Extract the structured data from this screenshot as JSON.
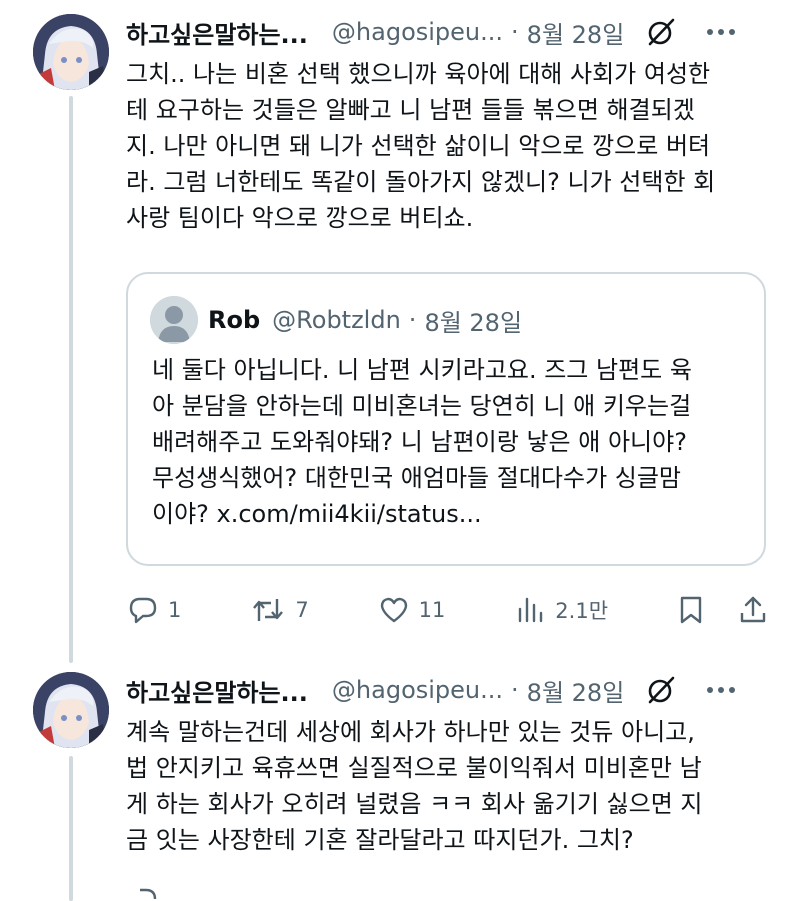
{
  "tweets": [
    {
      "author_name": "하고싶은말하는...",
      "handle": "@hagosipeu...",
      "separator": "·",
      "date": "8월 28일",
      "text": "그치.. 나는 비혼 선택 했으니까 육아에 대해 사회가 여성한\n테 요구하는 것들은 알빠고 니 남편 들들 볶으면 해결되겠\n지. 나만 아니면 돼 니가 선택한 삶이니 악으로 깡으로 버텨\n라. 그럼 너한테도 똑같이 돌아가지 않겠니? 니가 선택한 회\n사랑 팀이다 악으로 깡으로 버티쇼.",
      "quote": {
        "author_name": "Rob",
        "handle": "@Robtzldn",
        "separator": "·",
        "date": "8월 28일",
        "text": "네 둘다 아닙니다. 니 남편 시키라고요. 즈그 남편도 육\n아 분담을 안하는데 미비혼녀는 당연히 니 애 키우는걸\n배려해주고 도와줘야돼? 니 남편이랑 낳은 애 아니야?\n무성생식했어? 대한민국 애엄마들 절대다수가 싱글맘\n이야? x.com/mii4kii/status..."
      },
      "stats": {
        "replies": "1",
        "reposts": "7",
        "likes": "11",
        "views": "2.1만"
      }
    },
    {
      "author_name": "하고싶은말하는...",
      "handle": "@hagosipeu...",
      "separator": "·",
      "date": "8월 28일",
      "text": "계속 말하는건데 세상에 회사가 하나만 있는 것듀 아니고,\n법 안지키고 육휴쓰면 실질적으로 불이익줘서 미비혼만 남\n게 하는 회사가 오히려 널렸음 ㅋㅋ 회사 옮기기 싫으면 지\n금 잇는 사장한테 기혼 잘라달라고 따지던가. 그치?"
    }
  ],
  "icons": {
    "grok": "grok-icon",
    "more": "more-icon",
    "reply": "reply-icon",
    "repost": "repost-icon",
    "like": "heart-icon",
    "views": "views-icon",
    "bookmark": "bookmark-icon",
    "share": "share-icon"
  },
  "colors": {
    "text": "#0f1419",
    "secondary": "#536471",
    "border": "#cfd9de"
  }
}
